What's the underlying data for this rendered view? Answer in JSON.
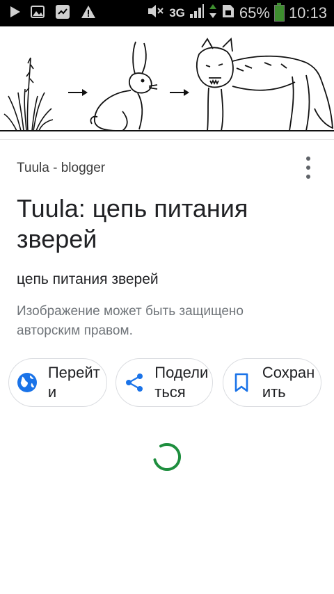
{
  "status_bar": {
    "network": "3G",
    "battery_percent": "65%",
    "time": "10:13"
  },
  "result": {
    "source": "Tuula - blogger",
    "title": "Tuula: цепь питания зверей",
    "subtitle": "цепь питания зверей",
    "copyright_note": "Изображение может быть защищено авторским правом."
  },
  "actions": {
    "visit": "Перейти",
    "share": "Поделиться",
    "save": "Сохранить"
  },
  "colors": {
    "accent": "#1a73e8",
    "spinner": "#1e8e3e"
  }
}
